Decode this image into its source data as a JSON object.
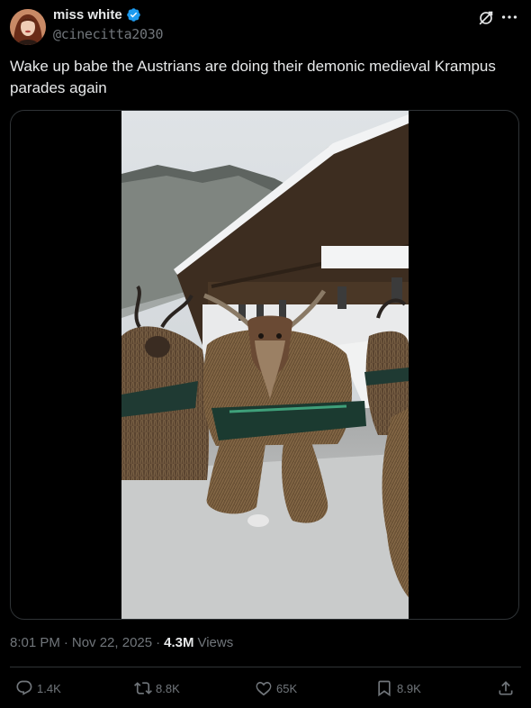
{
  "author": {
    "display_name": "miss white",
    "handle": "@cinecitta2030"
  },
  "tweet": {
    "text": "Wake up babe the Austrians are doing their demonic medieval Krampus parades again"
  },
  "meta": {
    "time": "8:01 PM",
    "separator": "·",
    "date": "Nov 22, 2025",
    "separator2": "·",
    "views_count": "4.3M",
    "views_label": "Views"
  },
  "actions": {
    "replies": "1.4K",
    "reposts": "8.8K",
    "likes": "65K",
    "bookmarks": "8.9K"
  },
  "colors": {
    "background": "#000000",
    "text": "#e7e9ea",
    "muted": "#71767b",
    "border": "#2f3336",
    "verified": "#1d9bf0"
  },
  "icons": [
    "verified-badge-icon",
    "grok-icon",
    "more-icon",
    "reply-icon",
    "repost-icon",
    "like-icon",
    "bookmark-icon",
    "share-icon"
  ]
}
